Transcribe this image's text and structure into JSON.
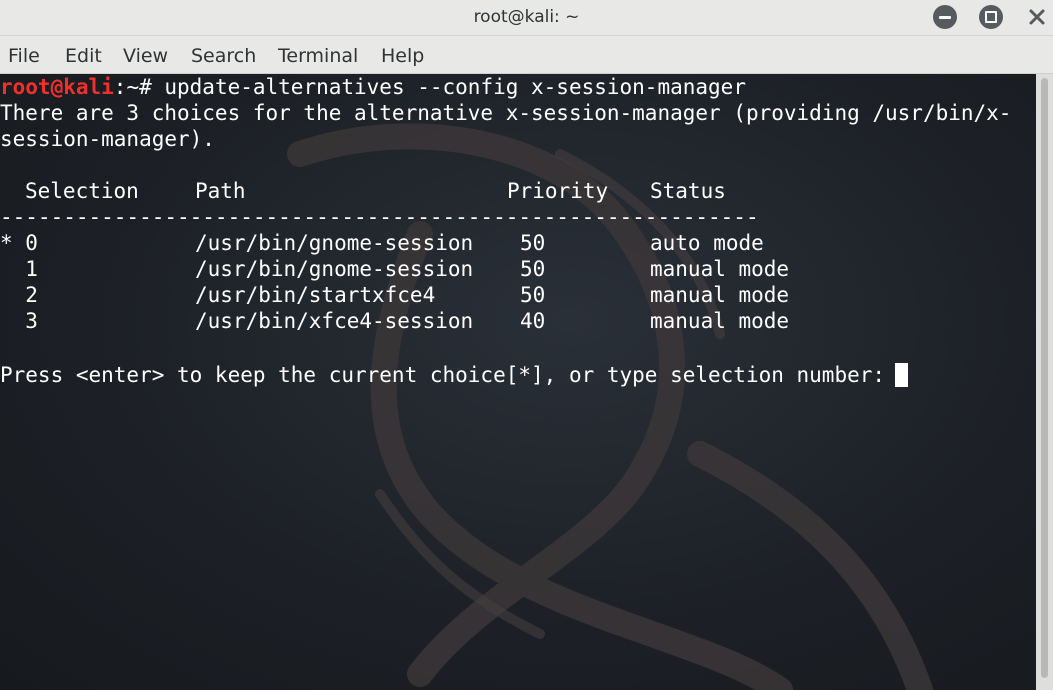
{
  "window": {
    "title": "root@kali: ~"
  },
  "menu": {
    "items": [
      "File",
      "Edit",
      "View",
      "Search",
      "Terminal",
      "Help"
    ]
  },
  "terminal": {
    "prompt_user": "root@kali",
    "prompt_rest": ":~# ",
    "command": "update-alternatives --config x-session-manager",
    "info_line_1": "There are 3 choices for the alternative x-session-manager (providing /usr/bin/x-",
    "info_line_2": "session-manager).",
    "table": {
      "headers": {
        "selection": "Selection",
        "path": "Path",
        "priority": "Priority",
        "status": "Status"
      },
      "separator": "------------------------------------------------------------",
      "rows": [
        {
          "selection": "* 0",
          "path": "/usr/bin/gnome-session",
          "priority": "50",
          "status": "auto mode"
        },
        {
          "selection": "  1",
          "path": "/usr/bin/gnome-session",
          "priority": "50",
          "status": "manual mode"
        },
        {
          "selection": "  2",
          "path": "/usr/bin/startxfce4",
          "priority": "50",
          "status": "manual mode"
        },
        {
          "selection": "  3",
          "path": "/usr/bin/xfce4-session",
          "priority": "40",
          "status": "manual mode"
        }
      ]
    },
    "input_prompt": "Press <enter> to keep the current choice[*], or type selection number:"
  },
  "colors": {
    "prompt": "#f0302c",
    "text": "#ffffff",
    "background": "#1d2127",
    "chrome": "#e8e8e7"
  },
  "icons": {
    "minimize": "minimize-icon",
    "maximize": "maximize-icon",
    "close": "close-icon",
    "background": "kali-dragon-watermark"
  }
}
